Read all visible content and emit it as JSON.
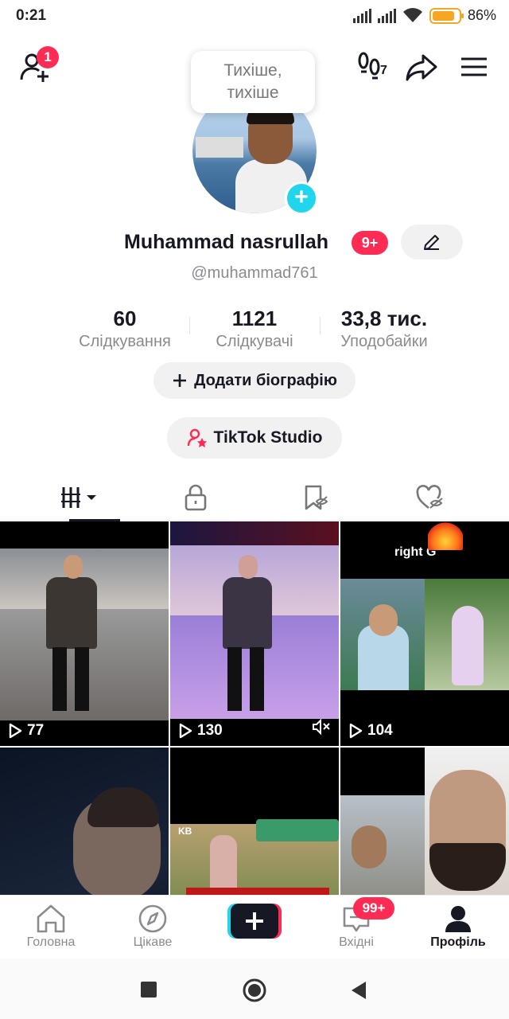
{
  "status_bar": {
    "time": "0:21",
    "battery_percent": "86%",
    "battery_level": 0.86
  },
  "top": {
    "add_friend_badge": "1",
    "footprints_count": "7"
  },
  "tooltip": {
    "line1": "Тихіше,",
    "line2": "тихіше"
  },
  "profile": {
    "name": "Muhammad nasrullah",
    "name_badge": "9+",
    "handle": "@muhammad761"
  },
  "stats": [
    {
      "value": "60",
      "label": "Слідкування"
    },
    {
      "value": "1121",
      "label": "Слідкувачі"
    },
    {
      "value": "33,8 тис.",
      "label": "Уподобайки"
    }
  ],
  "buttons": {
    "add_bio": "Додати біографію",
    "studio": "TikTok Studio"
  },
  "tabs": [
    "videos-grid",
    "private",
    "saved",
    "liked"
  ],
  "videos": [
    {
      "views": "77",
      "muted": false
    },
    {
      "views": "130",
      "muted": true
    },
    {
      "views": "104",
      "muted": false,
      "overlay_text": "right G"
    },
    {
      "views": ""
    },
    {
      "views": "",
      "overlay_text": "KB"
    },
    {
      "views": ""
    }
  ],
  "bottom_nav": {
    "home": "Головна",
    "discover": "Цікаве",
    "inbox": "Вхідні",
    "inbox_badge": "99+",
    "profile": "Профіль"
  },
  "colors": {
    "accent": "#fe2c55",
    "cyan": "#20d5ec",
    "text": "#161823",
    "muted": "#8a8b91"
  }
}
